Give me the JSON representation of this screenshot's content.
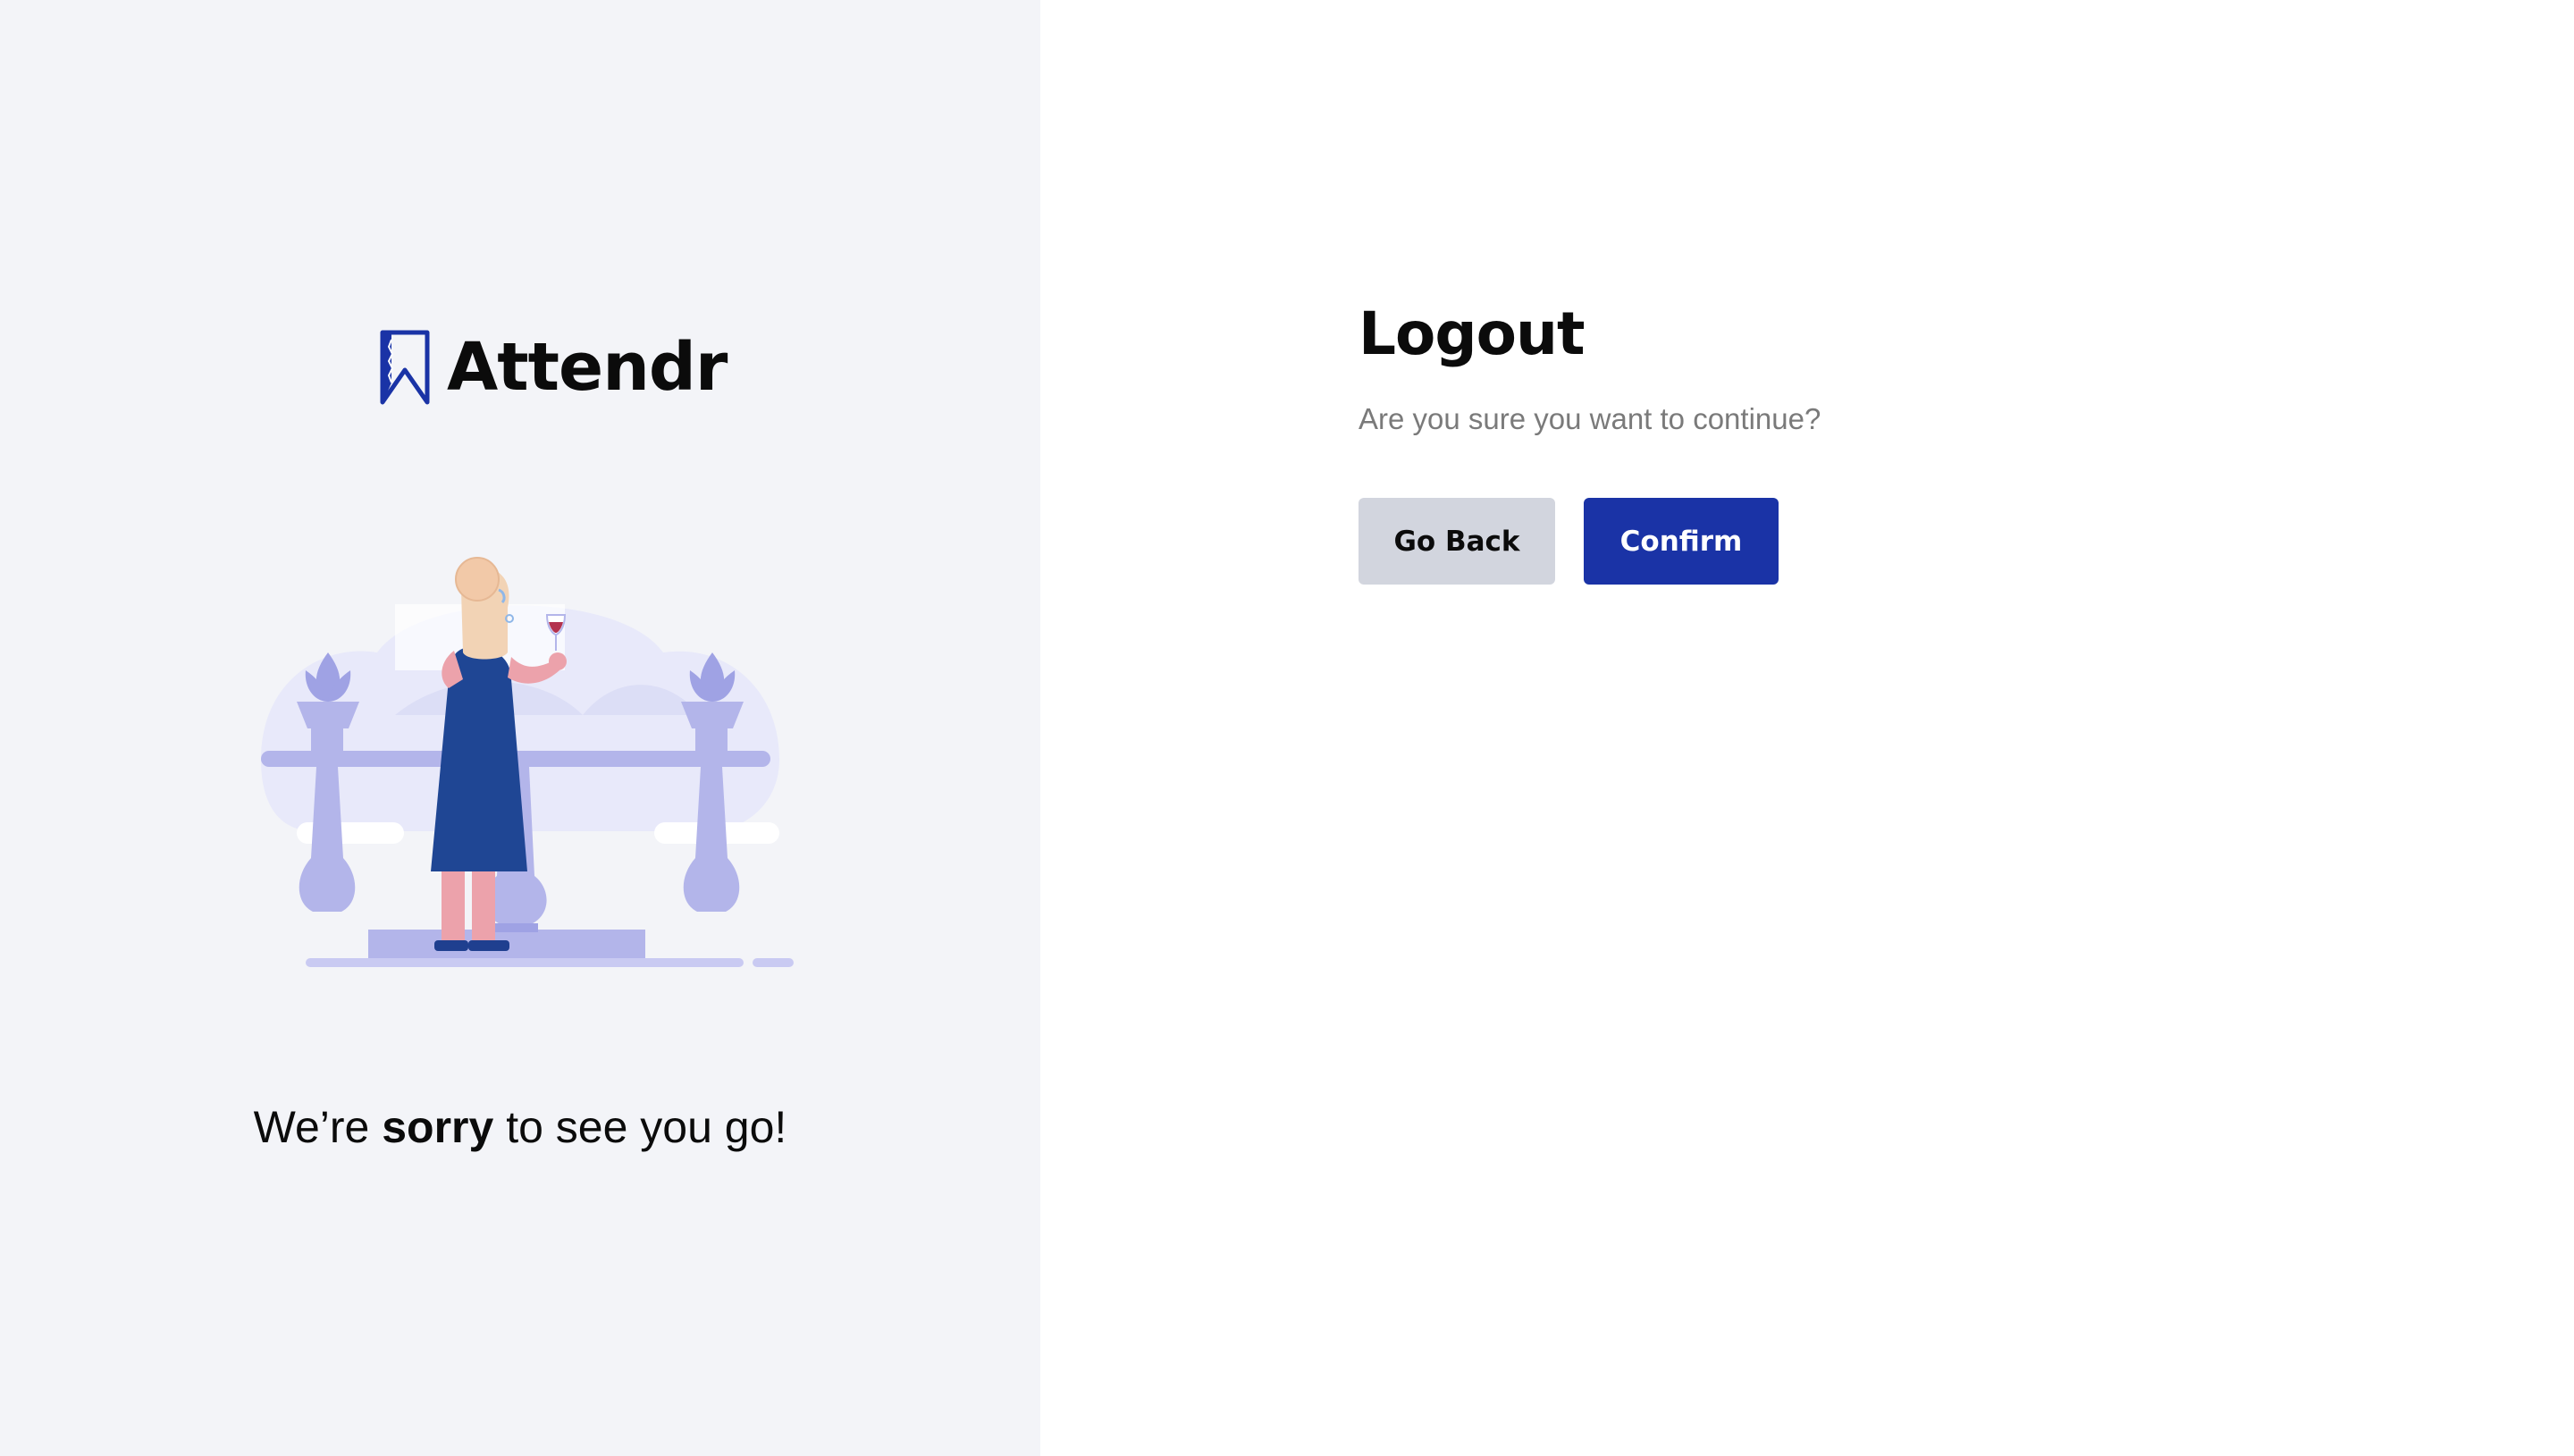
{
  "brand": {
    "name": "Attendr",
    "logo_icon": "bookmark-icon",
    "accent_color": "#1a33a6"
  },
  "farewell": {
    "prefix": "We’re ",
    "emphasis": "sorry",
    "suffix": " to see you go!"
  },
  "dialog": {
    "title": "Logout",
    "subtitle": "Are you sure you want to continue?",
    "back_label": "Go Back",
    "confirm_label": "Confirm"
  },
  "colors": {
    "left_background": "#f3f4f8",
    "back_button": "#d2d5de",
    "confirm_button": "#1a33a6"
  }
}
